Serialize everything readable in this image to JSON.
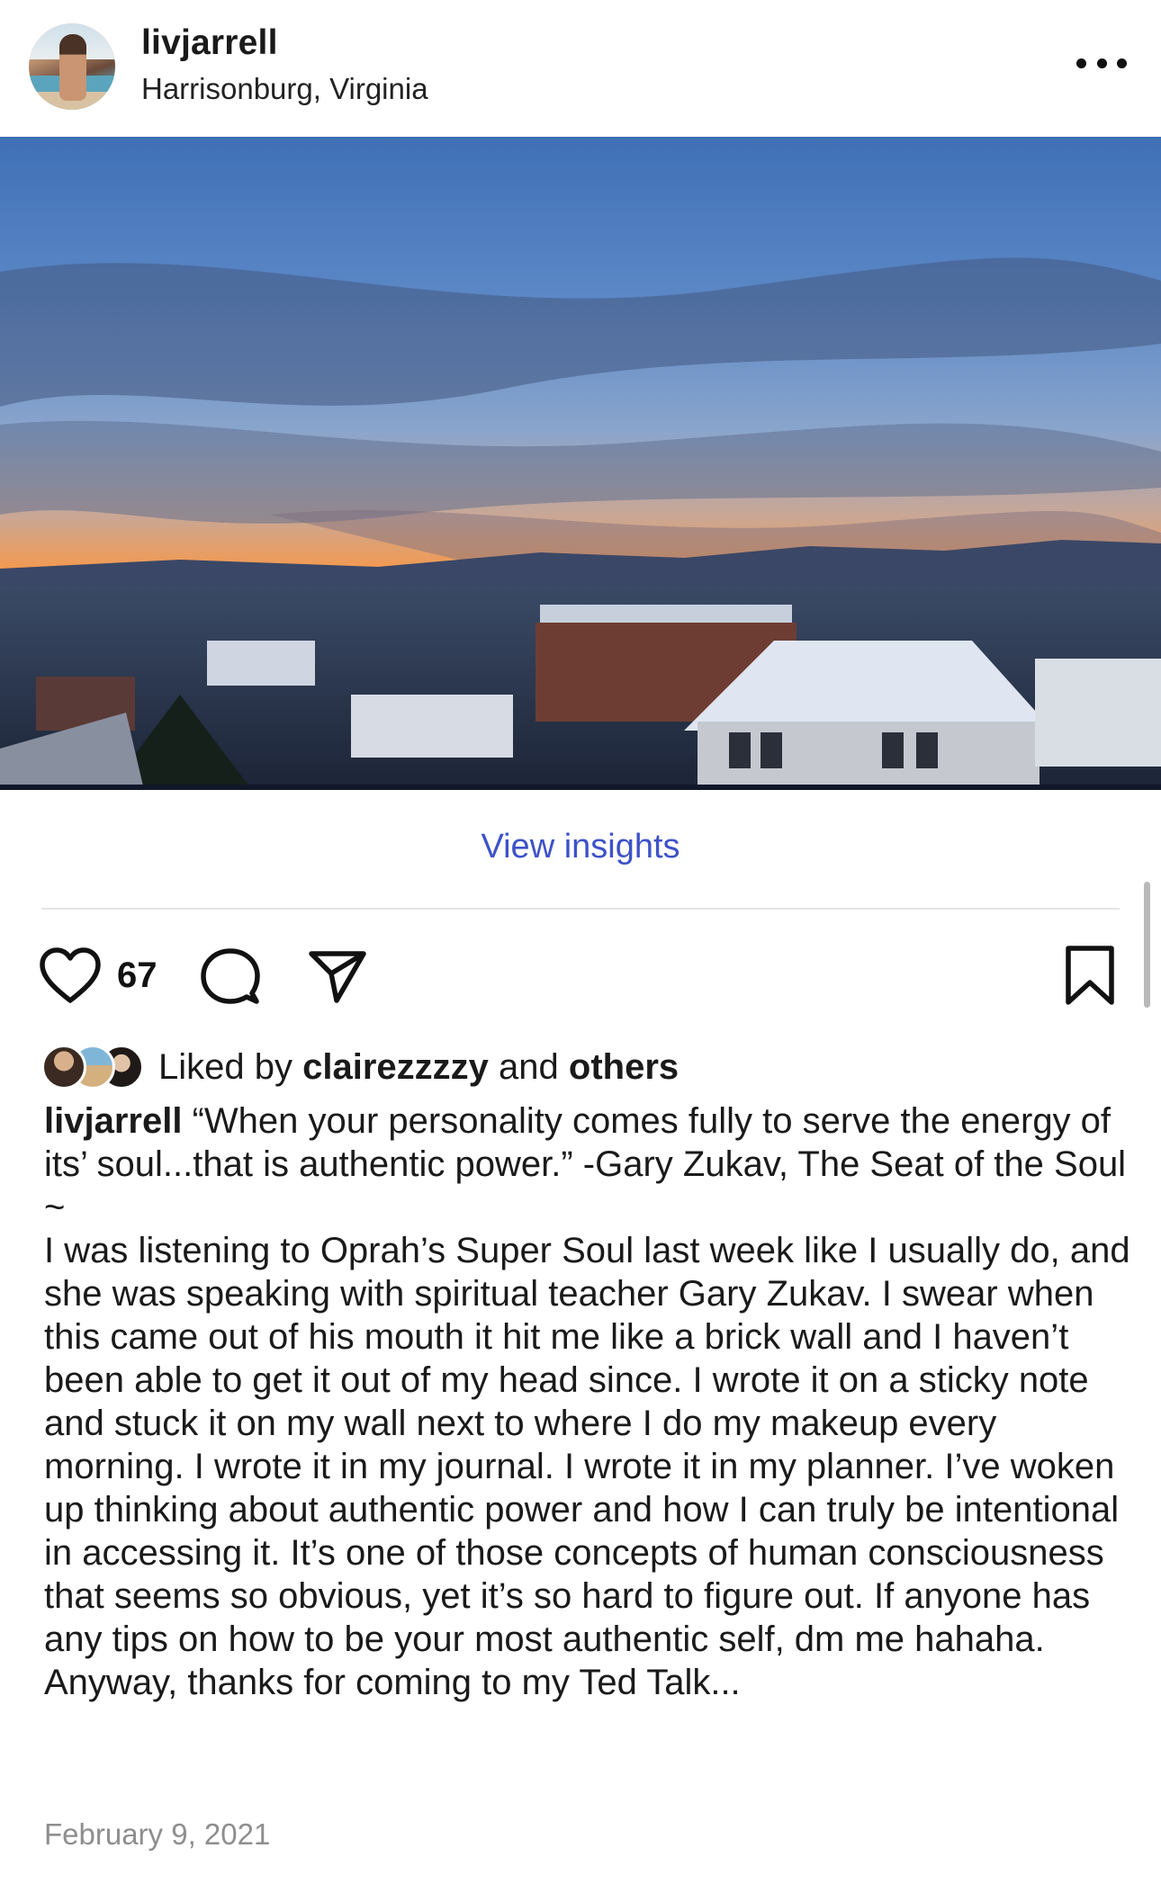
{
  "post": {
    "username": "livjarrell",
    "location": "Harrisonburg, Virginia",
    "view_insights": "View insights",
    "like_count": "67",
    "liked_by": {
      "prefix": "Liked by",
      "user": "clairezzzzy",
      "joiner": "and",
      "others": "others"
    },
    "caption_user": "livjarrell",
    "caption_text": "“When your personality comes fully to serve the energy of its’ soul...that is authentic power.” -Gary Zukav, The Seat of the Soul\n~\nI was listening to Oprah’s Super Soul last week like I usually do, and she was speaking with spiritual teacher Gary Zukav. I swear when this came out of his mouth it hit me like a brick wall and I haven’t been able to get it out of my head since. I wrote it on a sticky note and stuck it on my wall next to where I do my makeup every morning. I wrote it in my journal. I wrote it in my planner. I’ve woken up thinking about authentic power and how I can truly be intentional in accessing it. It’s one of those concepts of human consciousness that seems so obvious, yet it’s so hard to figure out. If anyone has any tips on how to be your most authentic self, dm me hahaha. Anyway, thanks for coming to my Ted Talk...",
    "date": "February 9, 2021"
  },
  "icons": {
    "more": "more-options-icon",
    "like": "heart-icon",
    "comment": "comment-icon",
    "share": "share-icon",
    "save": "bookmark-icon"
  },
  "colors": {
    "link": "#3d52c8",
    "muted": "#8e8e8e",
    "text": "#1a1a1a"
  }
}
